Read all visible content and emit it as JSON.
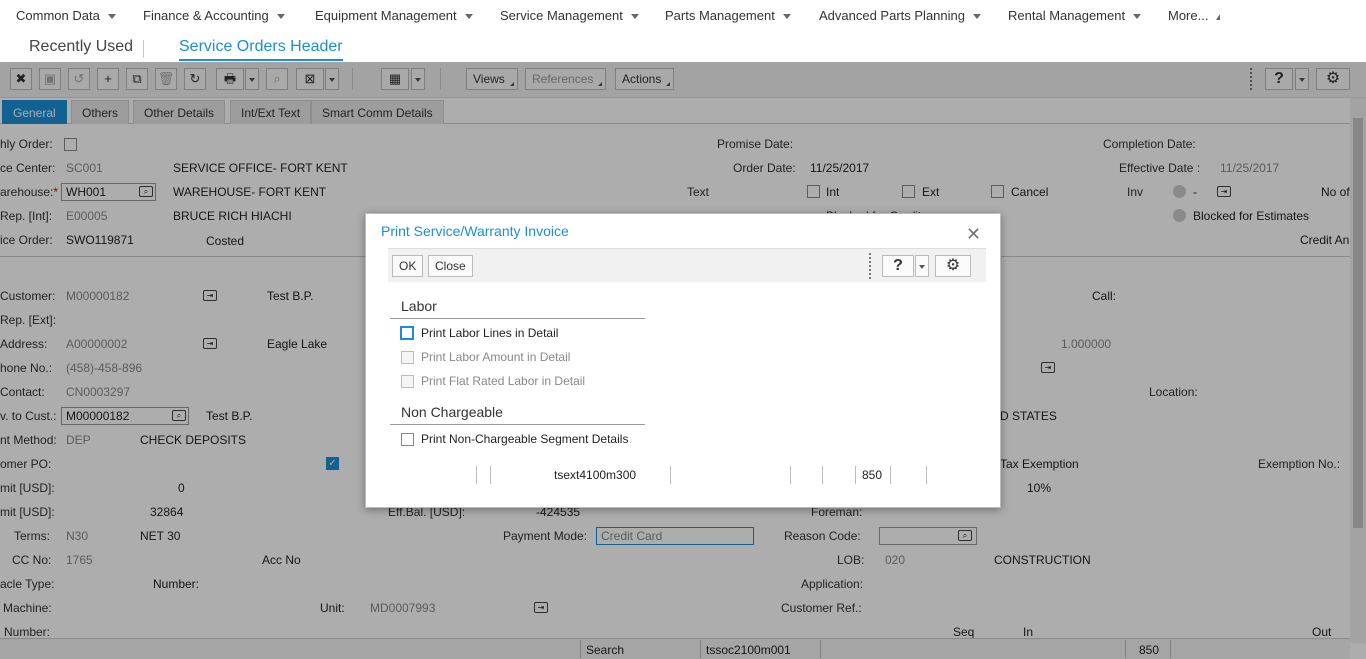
{
  "menu": {
    "items": [
      "Common Data",
      "Finance & Accounting",
      "Equipment Management",
      "Service Management",
      "Parts Management",
      "Advanced Parts Planning",
      "Rental Management",
      "More..."
    ]
  },
  "tabs": {
    "recently_used": "Recently Used",
    "active": "Service Orders Header"
  },
  "toolbar": {
    "views": "Views",
    "references": "References",
    "actions": "Actions",
    "help": "?"
  },
  "subtabs": [
    "General",
    "Others",
    "Other Details",
    "Int/Ext Text",
    "Smart Comm Details"
  ],
  "form": {
    "monthly_order": "hly Order:",
    "service_center_label": "ce Center:",
    "service_center_code": "SC001",
    "service_center_name": "SERVICE OFFICE- FORT KENT",
    "warehouse_label": "arehouse:",
    "warehouse_req": "*",
    "warehouse_code": "WH001",
    "warehouse_name": "WAREHOUSE- FORT KENT",
    "rep_int_label": "Rep. [Int]:",
    "rep_int_code": "E00005",
    "rep_int_name": "BRUCE RICH HIACHI",
    "service_order_label": "ice Order:",
    "service_order_code": "SWO119871",
    "service_order_status": "Costed",
    "promise_date_label": "Promise Date:",
    "order_date_label": "Order Date:",
    "order_date": "11/25/2017",
    "text_label": "Text",
    "int_label": "Int",
    "ext_label": "Ext",
    "cancel_label": "Cancel",
    "completion_date_label": "Completion Date:",
    "effective_date_label": "Effective Date :",
    "effective_date": "11/25/2017",
    "inv_label": "Inv",
    "inv_value": "-",
    "no_of_label": "No of",
    "blocked_estimates": "Blocked for Estimates",
    "blocked_credit": "Blocked for Credit",
    "credit_an_label": "Credit An",
    "customer_label": "Customer:",
    "customer_code": "M00000182",
    "customer_name": "Test B.P.",
    "rep_ext_label": "Rep. [Ext]:",
    "address_label": "Address:",
    "address_code": "A00000002",
    "address_city": "Eagle Lake",
    "phone_label": "hone No.:",
    "phone": "(458)-458-896",
    "contact_label": "Contact:",
    "contact": "CN0003297",
    "inv_to_cust_label": "v. to Cust.:",
    "inv_to_cust_code": "M00000182",
    "inv_to_cust_name": "Test B.P.",
    "payment_method_label": "nt Method:",
    "payment_method_code": "DEP",
    "payment_method_name": "CHECK DEPOSITS",
    "customer_po_label": "omer PO:",
    "limit1_label": "mit [USD]:",
    "limit1": "0",
    "limit2_label": "mit [USD]:",
    "limit2": "32864",
    "eff_bal_label": "Eff.Bal. [USD]:",
    "eff_bal": "-424535",
    "terms_label": "Terms:",
    "terms_code": "N30",
    "terms_name": "NET 30",
    "payment_mode_label": "Payment Mode:",
    "payment_mode": "Credit Card",
    "reason_code_label": "Reason Code:",
    "cc_no_label": "CC No:",
    "cc_no": "1765",
    "acc_no_label": "Acc No",
    "lob_label": "LOB:",
    "lob_code": "020",
    "lob_name": "CONSTRUCTION",
    "vehicle_type_label": "acle Type:",
    "number_label": "Number:",
    "application_label": "Application:",
    "machine_label": "Machine:",
    "unit_label": "Unit:",
    "unit": "MD0007993",
    "customer_ref_label": "Customer Ref.:",
    "number2_label": "Number:",
    "call_label": "Call:",
    "rate": "1.000000",
    "location_label": "Location:",
    "states": "D STATES",
    "tax_exemption_label": "Tax Exemption",
    "tax_pct": "10%",
    "exemption_no_label": "Exemption No.:",
    "foreman_label": "Foreman:",
    "seq_label": "Seq",
    "in_label": "In",
    "out_label": "Out",
    "search_label": "Search",
    "bottom_session": "tssoc2100m001",
    "bottom_num": "850"
  },
  "dialog": {
    "title": "Print Service/Warranty Invoice",
    "ok": "OK",
    "close": "Close",
    "help": "?",
    "labor_group": "Labor",
    "labor_items": [
      "Print Labor Lines in Detail",
      "Print Labor Amount in Detail",
      "Print Flat Rated Labor in Detail"
    ],
    "nonchargeable_group": "Non Chargeable",
    "nonchargeable_item": "Print Non-Chargeable Segment Details",
    "status_session": "tsext4100m300",
    "status_num": "850"
  },
  "colors": {
    "accent": "#1a8fd8"
  }
}
